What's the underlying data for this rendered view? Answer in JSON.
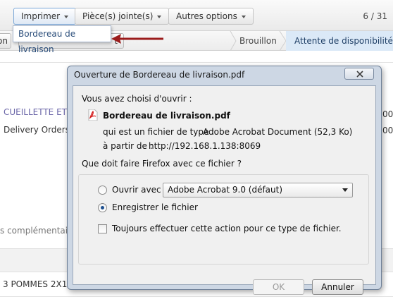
{
  "toolbar": {
    "print_label": "Imprimer",
    "attachments_label": "Pièce(s) jointe(s)",
    "more_options_label": "Autres options",
    "pager": "6 / 31"
  },
  "print_menu": {
    "items": [
      "Bordereau de livraison"
    ]
  },
  "statusbar": {
    "left_partial_button": "on",
    "second_partial_button": "t",
    "steps": [
      "Brouillon",
      "Attente de disponibilité"
    ]
  },
  "background": {
    "link_text": "CUEILLETTE ET",
    "delivery_text": "Delivery Orders",
    "value_right_1": "00",
    "value_right_2": "00",
    "section_text": "s complémentair",
    "row_text": "3 POMMES 2X12"
  },
  "dialog": {
    "title": "Ouverture de Bordereau de livraison.pdf",
    "intro": "Vous avez choisi d'ouvrir :",
    "file_name": "Bordereau de livraison.pdf",
    "type_label": "qui est un fichier de type :",
    "type_value": "Adobe Acrobat Document (52,3 Ko)",
    "from_label": "à partir de :",
    "from_value": "http://192.168.1.138:8069",
    "question": "Que doit faire Firefox avec ce fichier ?",
    "open_with_label": "Ouvrir avec",
    "open_with_app": "Adobe Acrobat 9.0 (défaut)",
    "save_label": "Enregistrer le fichier",
    "always_label": "Toujours effectuer cette action pour ce type de fichier.",
    "ok_label": "OK",
    "cancel_label": "Annuler",
    "selected_option": "save"
  },
  "colors": {
    "annotation_arrow": "#9b1c1c",
    "link_color": "#6b66a8",
    "current_step": "#dbe9f7"
  },
  "icons": {
    "file_icon": "pdf-icon",
    "annotation": "red-arrow"
  }
}
